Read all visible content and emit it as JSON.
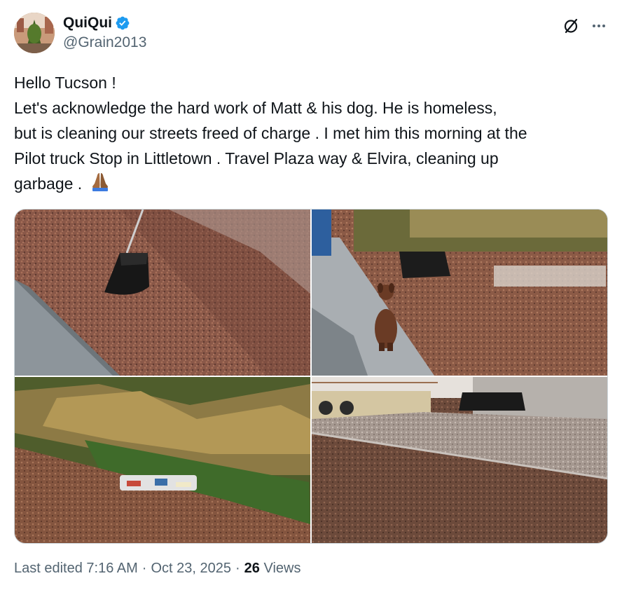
{
  "author": {
    "display_name": "QuiQui",
    "handle": "@Grain2013",
    "verified": true,
    "avatar_icon": "avatar-street-photo"
  },
  "actions": {
    "grok_icon": "slashed-circle-icon",
    "more_icon": "more-dots-icon"
  },
  "post": {
    "lines": [
      "Hello Tucson !",
      "Let's  acknowledge the hard work   of Matt & his dog.  He is homeless,",
      "but is cleaning our streets  freed of charge . I met him this morning  at the",
      "Pilot truck Stop in Littletown . Travel  Plaza way &  Elvira,  cleaning  up",
      "garbage . "
    ],
    "emoji_icon": "praying-hands-icon"
  },
  "media": {
    "photos": [
      {
        "subject": "trash-bag-on-grabber-photo"
      },
      {
        "subject": "dog-on-sidewalk-photo"
      },
      {
        "subject": "litter-by-bushes-photo"
      },
      {
        "subject": "culvert-and-gravel-photo"
      }
    ]
  },
  "meta": {
    "edited_label": "Last edited 7:16 AM",
    "separator": "·",
    "date": "Oct 23, 2025",
    "views_count": "26",
    "views_label": "Views"
  },
  "colors": {
    "text_primary": "#0f1419",
    "text_secondary": "#536471",
    "verified_blue": "#1d9bf0",
    "border": "#cfd9de"
  }
}
